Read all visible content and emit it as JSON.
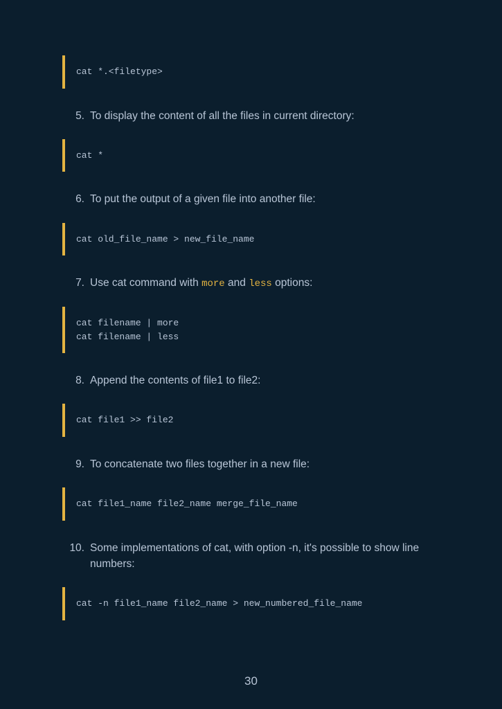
{
  "code_blocks": {
    "block0": "cat *.<filetype>",
    "block1": "cat *",
    "block2": "cat old_file_name > new_file_name",
    "block3": "cat filename | more\ncat filename | less",
    "block4": "cat file1 >> file2",
    "block5": "cat file1_name file2_name merge_file_name",
    "block6": "cat -n file1_name file2_name > new_numbered_file_name"
  },
  "items": {
    "n5": "5.",
    "t5": "To display the content of all the files in current directory:",
    "n6": "6.",
    "t6": "To put the output of a given file into another file:",
    "n7": "7.",
    "t7_a": "Use cat command with ",
    "t7_more": "more",
    "t7_b": " and ",
    "t7_less": "less",
    "t7_c": " options:",
    "n8": "8.",
    "t8": "Append the contents of file1 to file2:",
    "n9": "9.",
    "t9": "To concatenate two files together in a new file:",
    "n10": "10.",
    "t10": "Some implementations of cat, with option -n, it's possible to show line numbers:"
  },
  "page_number": "30"
}
